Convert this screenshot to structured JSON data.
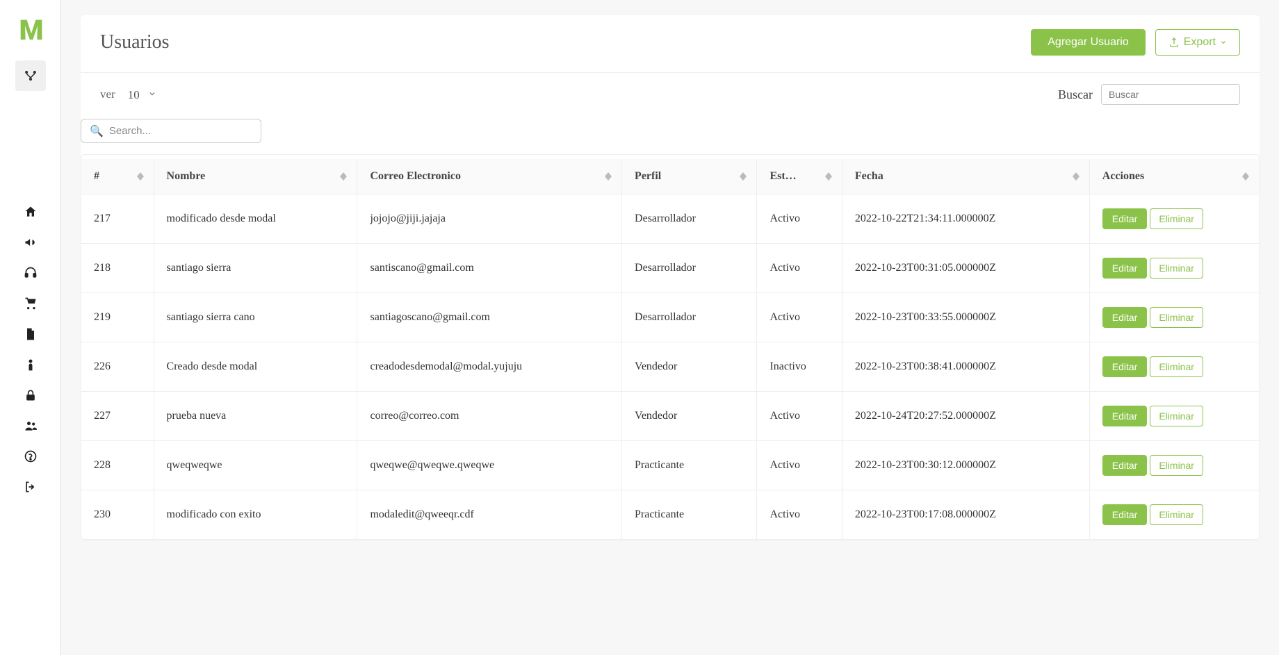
{
  "sidebar": {
    "logo": "M"
  },
  "header": {
    "title": "Usuarios",
    "add_button": "Agregar Usuario",
    "export_button": "Export"
  },
  "controls": {
    "ver_label": "ver",
    "ver_value": "10",
    "buscar_label": "Buscar",
    "buscar_placeholder": "Buscar",
    "search_placeholder": "Search..."
  },
  "table": {
    "columns": {
      "id": "#",
      "nombre": "Nombre",
      "correo": "Correo Electronico",
      "perfil": "Perfil",
      "estado": "Est…",
      "fecha": "Fecha",
      "acciones": "Acciones"
    },
    "actions": {
      "edit": "Editar",
      "delete": "Eliminar"
    },
    "rows": [
      {
        "id": "217",
        "nombre": "modificado desde modal",
        "correo": "jojojo@jiji.jajaja",
        "perfil": "Desarrollador",
        "estado": "Activo",
        "fecha": "2022-10-22T21:34:11.000000Z"
      },
      {
        "id": "218",
        "nombre": "santiago sierra",
        "correo": "santiscano@gmail.com",
        "perfil": "Desarrollador",
        "estado": "Activo",
        "fecha": "2022-10-23T00:31:05.000000Z"
      },
      {
        "id": "219",
        "nombre": "santiago sierra cano",
        "correo": "santiagoscano@gmail.com",
        "perfil": "Desarrollador",
        "estado": "Activo",
        "fecha": "2022-10-23T00:33:55.000000Z"
      },
      {
        "id": "226",
        "nombre": "Creado desde modal",
        "correo": "creadodesdemodal@modal.yujuju",
        "perfil": "Vendedor",
        "estado": "Inactivo",
        "fecha": "2022-10-23T00:38:41.000000Z"
      },
      {
        "id": "227",
        "nombre": "prueba nueva",
        "correo": "correo@correo.com",
        "perfil": "Vendedor",
        "estado": "Activo",
        "fecha": "2022-10-24T20:27:52.000000Z"
      },
      {
        "id": "228",
        "nombre": "qweqweqwe",
        "correo": "qweqwe@qweqwe.qweqwe",
        "perfil": "Practicante",
        "estado": "Activo",
        "fecha": "2022-10-23T00:30:12.000000Z"
      },
      {
        "id": "230",
        "nombre": "modificado con exito",
        "correo": "modaledit@qweeqr.cdf",
        "perfil": "Practicante",
        "estado": "Activo",
        "fecha": "2022-10-23T00:17:08.000000Z"
      }
    ]
  }
}
